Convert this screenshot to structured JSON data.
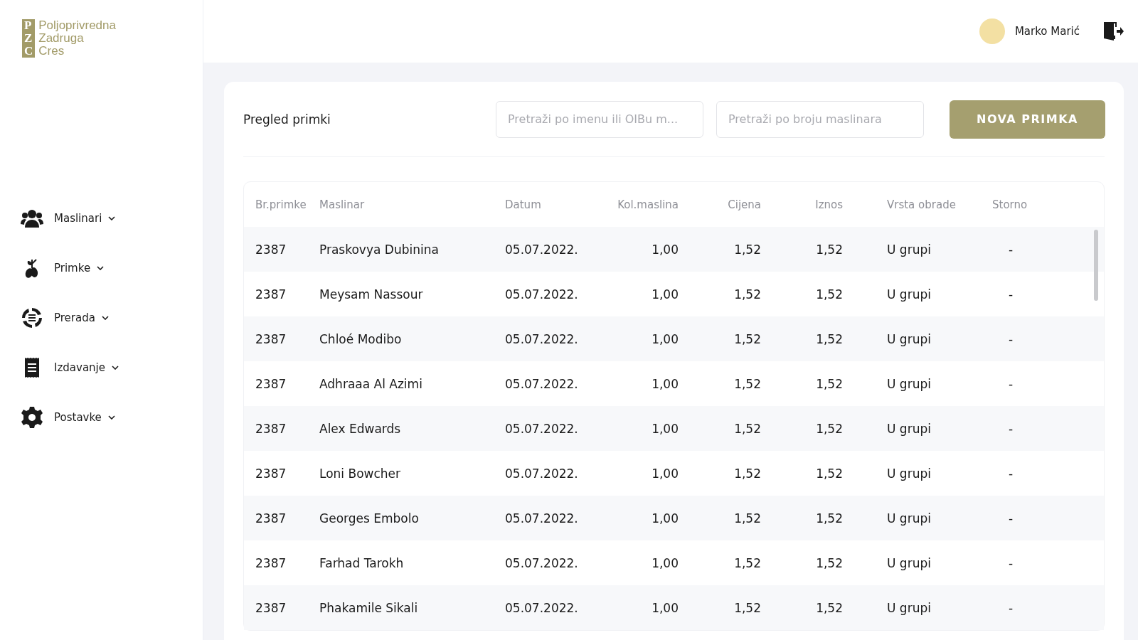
{
  "logo": {
    "mark": [
      "P",
      "Z",
      "C"
    ],
    "lines": [
      "Poljoprivredna",
      "Zadruga",
      "Cres"
    ]
  },
  "sidebar": {
    "items": [
      {
        "label": "Maslinari",
        "expanded": false
      },
      {
        "label": "Primke",
        "expanded": false
      },
      {
        "label": "Prerada",
        "expanded": false
      },
      {
        "label": "Izdavanje",
        "expanded": false
      },
      {
        "label": "Postavke",
        "expanded": false
      }
    ]
  },
  "header": {
    "user_name": "Marko Marić"
  },
  "page": {
    "title": "Pregled primki",
    "search_name": {
      "placeholder": "Pretraži po imenu ili OIBu m..."
    },
    "search_number": {
      "placeholder": "Pretraži po broju maslinara"
    },
    "new_button": "NOVA PRIMKA"
  },
  "table": {
    "columns": [
      "Br.primke",
      "Maslinar",
      "Datum",
      "Kol.maslina",
      "Cijena",
      "Iznos",
      "Vrsta obrade",
      "Storno"
    ],
    "rows": [
      [
        "2387",
        "Praskovya Dubinina",
        "05.07.2022.",
        "1,00",
        "1,52",
        "1,52",
        "U grupi",
        "-"
      ],
      [
        "2387",
        "Meysam Nassour",
        "05.07.2022.",
        "1,00",
        "1,52",
        "1,52",
        "U grupi",
        "-"
      ],
      [
        "2387",
        "Chloé Modibo",
        "05.07.2022.",
        "1,00",
        "1,52",
        "1,52",
        "U grupi",
        "-"
      ],
      [
        "2387",
        "Adhraaa Al Azimi",
        "05.07.2022.",
        "1,00",
        "1,52",
        "1,52",
        "U grupi",
        "-"
      ],
      [
        "2387",
        "Alex Edwards",
        "05.07.2022.",
        "1,00",
        "1,52",
        "1,52",
        "U grupi",
        "-"
      ],
      [
        "2387",
        "Loni Bowcher",
        "05.07.2022.",
        "1,00",
        "1,52",
        "1,52",
        "U grupi",
        "-"
      ],
      [
        "2387",
        "Georges Embolo",
        "05.07.2022.",
        "1,00",
        "1,52",
        "1,52",
        "U grupi",
        "-"
      ],
      [
        "2387",
        "Farhad Tarokh",
        "05.07.2022.",
        "1,00",
        "1,52",
        "1,52",
        "U grupi",
        "-"
      ],
      [
        "2387",
        "Phakamile Sikali",
        "05.07.2022.",
        "1,00",
        "1,52",
        "1,52",
        "U grupi",
        "-"
      ]
    ]
  }
}
